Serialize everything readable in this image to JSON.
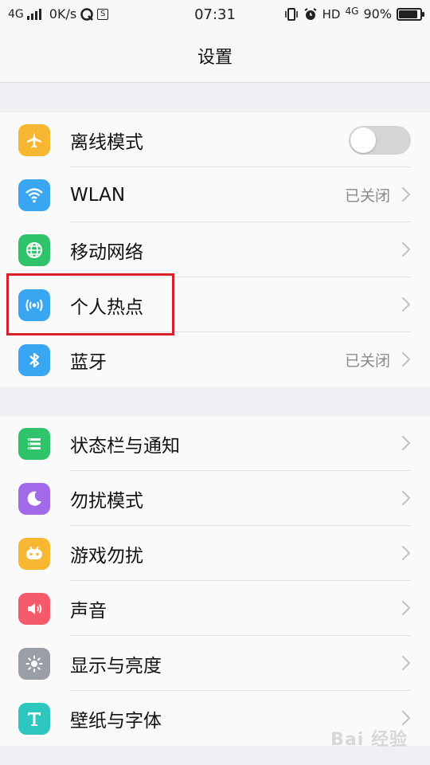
{
  "statusbar": {
    "network_left": "4G",
    "speed": "0K/s",
    "time": "07:31",
    "hd": "HD",
    "network_right": "4G",
    "battery_text": "90%",
    "battery_level": 0.9,
    "s_box": "S"
  },
  "header": {
    "title": "设置"
  },
  "groups": [
    {
      "items": [
        {
          "label": "离线模式",
          "icon": "airplane-icon",
          "color": "#f8b731",
          "control": "toggle",
          "toggle_on": false
        },
        {
          "label": "WLAN",
          "icon": "wifi-icon",
          "color": "#38a6f1",
          "value": "已关闭"
        },
        {
          "label": "移动网络",
          "icon": "globe-icon",
          "color": "#2fc36b"
        },
        {
          "label": "个人热点",
          "icon": "hotspot-icon",
          "color": "#38a6f1"
        },
        {
          "label": "蓝牙",
          "icon": "bluetooth-icon",
          "color": "#38a6f1",
          "value": "已关闭"
        }
      ]
    },
    {
      "items": [
        {
          "label": "状态栏与通知",
          "icon": "statusbar-icon",
          "color": "#2fc36b"
        },
        {
          "label": "勿扰模式",
          "icon": "moon-icon",
          "color": "#a26ae8"
        },
        {
          "label": "游戏勿扰",
          "icon": "gamepad-icon",
          "color": "#f8b731"
        },
        {
          "label": "声音",
          "icon": "speaker-icon",
          "color": "#f55a6b"
        },
        {
          "label": "显示与亮度",
          "icon": "sun-icon",
          "color": "#9a9ea6"
        },
        {
          "label": "壁纸与字体",
          "icon": "text-t-icon",
          "color": "#2ec7c0"
        }
      ]
    }
  ],
  "highlight_color": "#d7202a",
  "watermark": "Bai 经验"
}
